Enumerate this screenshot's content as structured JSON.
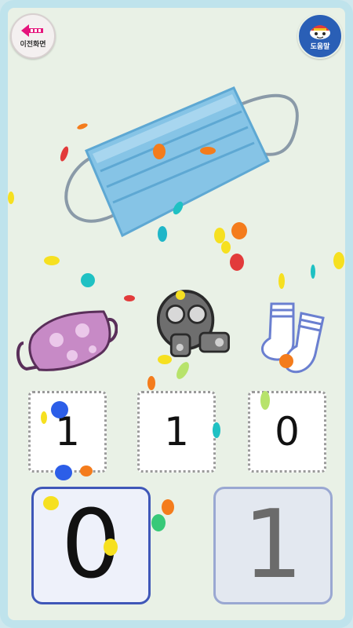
{
  "header": {
    "back_label": "이전화면",
    "help_label": "도움말"
  },
  "scene": {
    "main_item_icon": "surgical-mask",
    "items": [
      {
        "icon": "cloth-mask"
      },
      {
        "icon": "gas-mask"
      },
      {
        "icon": "socks"
      }
    ]
  },
  "counts": [
    "1",
    "1",
    "0"
  ],
  "answers": [
    "0",
    "1"
  ],
  "selected_answer": "0",
  "colors": {
    "frame": "#bfe3ec",
    "background": "#e9f1e6",
    "selected_border": "#3f57b8",
    "unselected_border": "#9aa8d2",
    "help_button": "#2a5fb6",
    "back_arrow": "#e5147c"
  }
}
